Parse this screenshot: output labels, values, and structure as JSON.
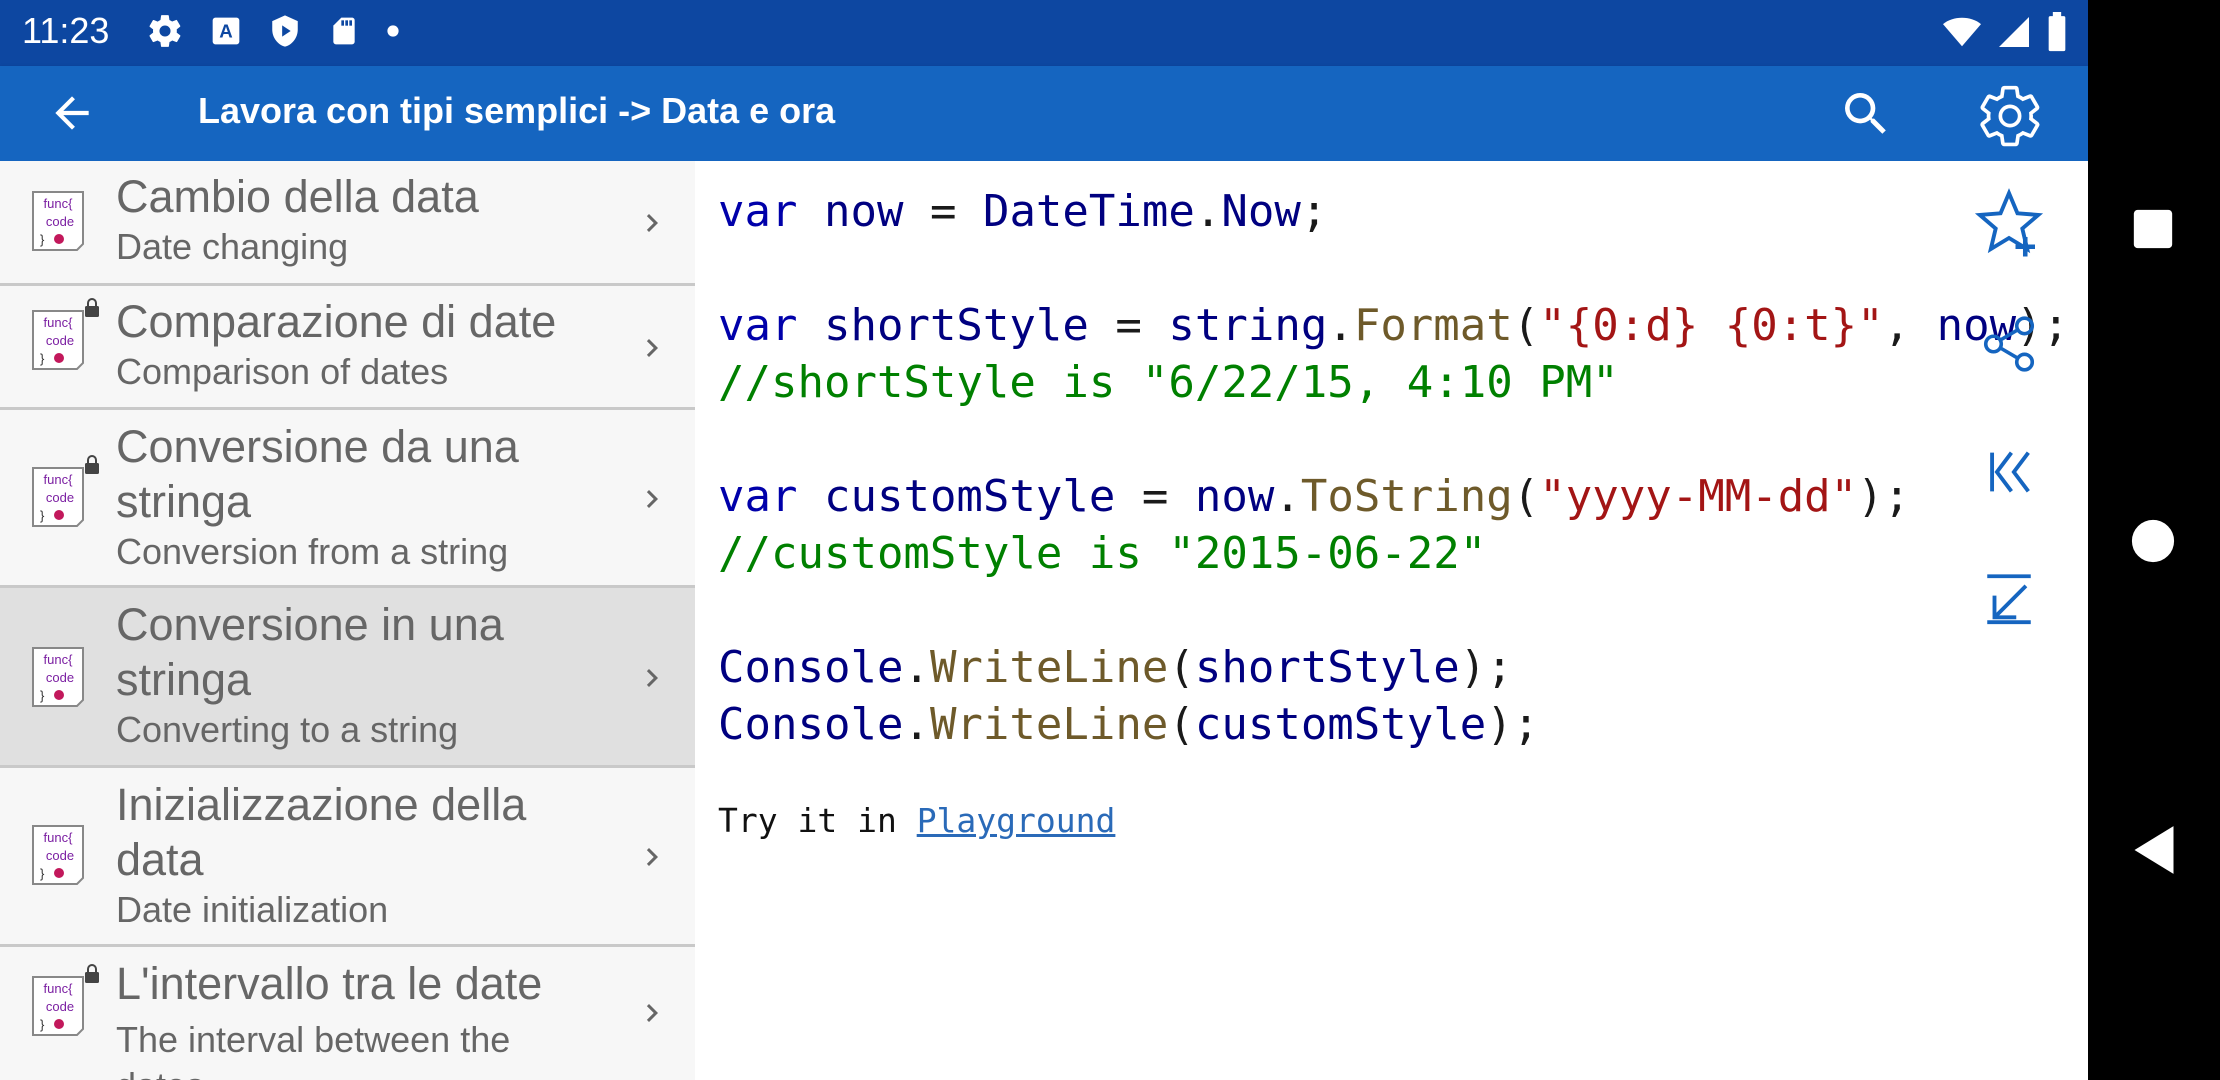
{
  "status_bar": {
    "time": "11:23",
    "left_icons": [
      "gear-icon",
      "font-a-icon",
      "shield-icon",
      "sd-card-icon",
      "dot-icon"
    ],
    "right_icons": [
      "wifi-icon",
      "cell-signal-icon",
      "battery-icon"
    ]
  },
  "app_bar": {
    "title": "Lavora con tipi semplici -> Data e ora",
    "back_icon": "arrow-back-icon",
    "search_icon": "search-icon",
    "settings_icon": "gear-icon"
  },
  "list": {
    "items": [
      {
        "title": "Cambio della data",
        "subtitle": "Date changing",
        "locked": false,
        "selected": false
      },
      {
        "title": "Comparazione di date",
        "subtitle": "Comparison of dates",
        "locked": true,
        "selected": false
      },
      {
        "title": "Conversione da una stringa",
        "title_line1": "Conversione da una",
        "title_line2": "stringa",
        "subtitle": "Conversion from a string",
        "locked": true,
        "selected": false
      },
      {
        "title": "Conversione in una stringa",
        "title_line1": "Conversione in una",
        "title_line2": "stringa",
        "subtitle": "Converting to a string",
        "locked": false,
        "selected": true
      },
      {
        "title": "Inizializzazione della data",
        "title_line1": "Inizializzazione della",
        "title_line2": "data",
        "subtitle": "Date initialization",
        "locked": false,
        "selected": false
      },
      {
        "title": "L'intervallo tra le date",
        "subtitle": "The interval between the",
        "subtitle_line2": "dates",
        "locked": true,
        "selected": false
      }
    ],
    "icon_text": {
      "line1": "func{",
      "line2": "code",
      "line3": "}"
    }
  },
  "code": {
    "l1_kw": "var",
    "l1_name": "now",
    "l1_type": "DateTime",
    "l1_member": "Now",
    "l2_kw": "var",
    "l2_name": "shortStyle",
    "l2_type": "string",
    "l2_fn": "Format",
    "l2_str": "\"{0:d} {0:t}\"",
    "l2_arg": "now",
    "l3_comment": "//shortStyle is \"6/22/15, 4:10 PM\"",
    "l4_kw": "var",
    "l4_name": "customStyle",
    "l4_obj": "now",
    "l4_fn": "ToString",
    "l4_str": "\"yyyy-MM-dd\"",
    "l5_comment": "//customStyle is \"2015-06-22\"",
    "l6_obj": "Console",
    "l6_fn": "WriteLine",
    "l6_arg": "shortStyle",
    "l7_obj": "Console",
    "l7_fn": "WriteLine",
    "l7_arg": "customStyle"
  },
  "try_it": {
    "prefix": "Try it in",
    "link": "Playground"
  },
  "side_actions": [
    "star-add-icon",
    "share-icon",
    "skip-first-icon",
    "arrow-down-left-icon"
  ],
  "nav_bar": {
    "icons": [
      "recents-icon",
      "home-icon",
      "back-icon"
    ]
  },
  "colors": {
    "status_bar": "#0d47a1",
    "app_bar": "#1565c0",
    "accent": "#1565c0"
  }
}
